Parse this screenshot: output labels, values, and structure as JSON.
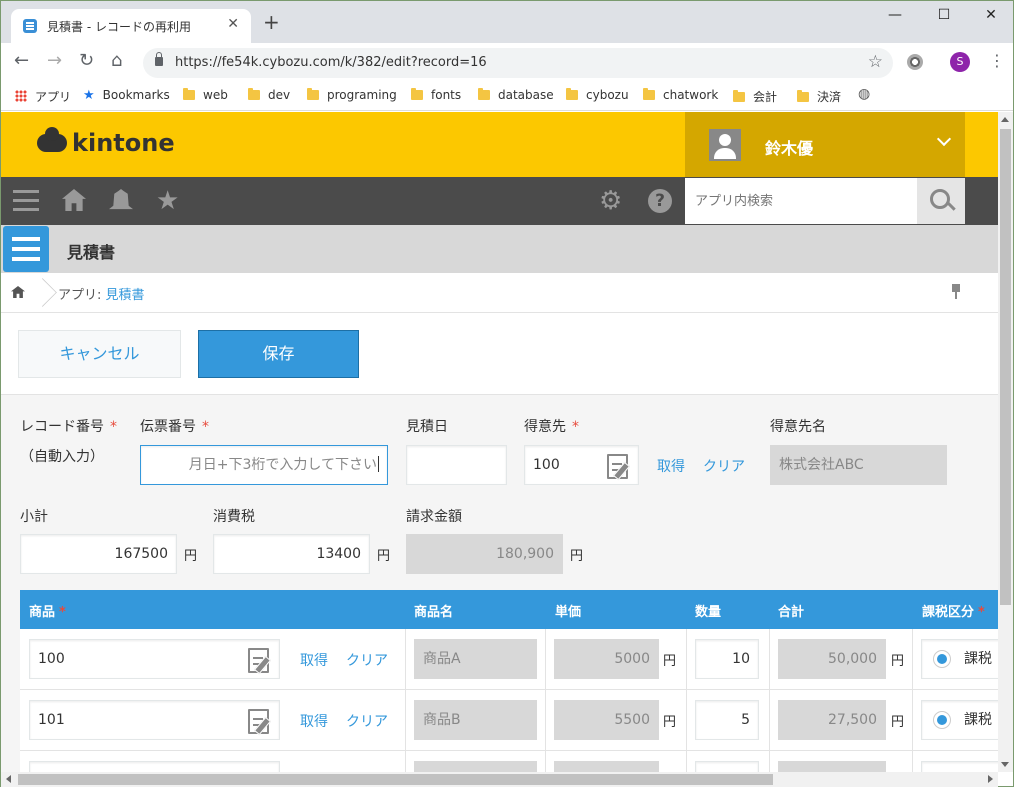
{
  "browser": {
    "tab_title": "見積書 - レコードの再利用",
    "tab_close": "✕",
    "new_tab": "+",
    "win_min": "—",
    "win_max": "☐",
    "win_close": "✕",
    "back": "←",
    "forward": "→",
    "reload": "↻",
    "home": "⌂",
    "url": "https://fe54k.cybozu.com/k/382/edit?record=16",
    "profile_initial": "S",
    "menu": "⋮",
    "star": "☆"
  },
  "bookmarks": [
    {
      "label": "アプリ",
      "icon": "apps-grid-icon"
    },
    {
      "label": "Bookmarks",
      "icon": "star-icon"
    },
    {
      "label": "web",
      "icon": "folder-icon"
    },
    {
      "label": "dev",
      "icon": "folder-icon"
    },
    {
      "label": "programing",
      "icon": "folder-icon"
    },
    {
      "label": "fonts",
      "icon": "folder-icon"
    },
    {
      "label": "database",
      "icon": "folder-icon"
    },
    {
      "label": "cybozu",
      "icon": "folder-icon"
    },
    {
      "label": "chatwork",
      "icon": "folder-icon"
    },
    {
      "label": "会計",
      "icon": "folder-icon"
    },
    {
      "label": "決済",
      "icon": "folder-icon"
    }
  ],
  "header": {
    "logo_text": "kintone",
    "user_name": "鈴木優",
    "search_placeholder": "アプリ内検索"
  },
  "app": {
    "title": "見積書",
    "breadcrumb_prefix": "アプリ: ",
    "breadcrumb_link": "見積書"
  },
  "actions": {
    "cancel": "キャンセル",
    "save": "保存"
  },
  "form": {
    "record_no_label": "レコード番号",
    "record_no_value": "（自動入力）",
    "voucher_no_label": "伝票番号",
    "voucher_no_placeholder": "月日+下3桁で入力して下さい",
    "estimate_date_label": "見積日",
    "estimate_date_value": "",
    "customer_label": "得意先",
    "customer_value": "100",
    "customer_name_label": "得意先名",
    "customer_name_value": "株式会社ABC",
    "get": "取得",
    "clear": "クリア",
    "required_mark": "*",
    "subtotal_label": "小計",
    "subtotal_value": "167500",
    "tax_label": "消費税",
    "tax_value": "13400",
    "billing_label": "請求金額",
    "billing_value": "180,900",
    "yen": "円"
  },
  "table": {
    "columns": [
      "商品",
      "商品名",
      "単価",
      "数量",
      "合計",
      "課税区分"
    ],
    "rows": [
      {
        "product": "100",
        "name": "商品A",
        "price": "5000",
        "qty": "10",
        "total": "50,000",
        "tax_type": "課税"
      },
      {
        "product": "101",
        "name": "商品B",
        "price": "5500",
        "qty": "5",
        "total": "27,500",
        "tax_type": "課税"
      }
    ]
  },
  "colors": {
    "kintone_yellow": "#fcc800",
    "user_box": "#d4a700",
    "nav_dark": "#4b4b4b",
    "accent_blue": "#3498db",
    "required_red": "#e74b3c"
  }
}
